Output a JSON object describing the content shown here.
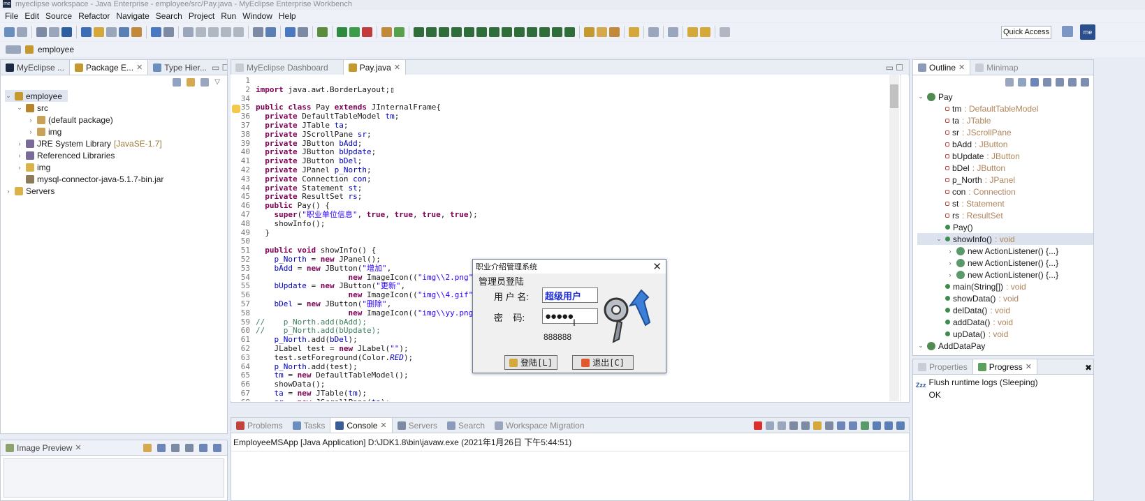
{
  "window": {
    "title": "myeclipse workspace - Java Enterprise - employee/src/Pay.java - MyEclipse Enterprise Workbench",
    "logo": "me"
  },
  "menu": [
    "File",
    "Edit",
    "Source",
    "Refactor",
    "Navigate",
    "Search",
    "Project",
    "Run",
    "Window",
    "Help"
  ],
  "quick_access": "Quick Access",
  "breadcrumb": "employee",
  "left_tabs": [
    {
      "label": "MyEclipse ..."
    },
    {
      "label": "Package E..."
    },
    {
      "label": "Type Hier..."
    }
  ],
  "tree": [
    {
      "label": "employee",
      "level": 0,
      "twisty": "v",
      "icon": "project"
    },
    {
      "label": "src",
      "level": 1,
      "twisty": "v",
      "icon": "srcfolder"
    },
    {
      "label": "(default package)",
      "level": 2,
      "twisty": ">",
      "icon": "package"
    },
    {
      "label": "img",
      "level": 2,
      "twisty": ">",
      "icon": "package"
    },
    {
      "label": "JRE System Library",
      "suffix": "[JavaSE-1.7]",
      "level": 1,
      "twisty": ">",
      "icon": "library"
    },
    {
      "label": "Referenced Libraries",
      "level": 1,
      "twisty": ">",
      "icon": "library"
    },
    {
      "label": "img",
      "level": 1,
      "twisty": ">",
      "icon": "folder"
    },
    {
      "label": "mysql-connector-java-5.1.7-bin.jar",
      "level": 1,
      "twisty": "",
      "icon": "jar"
    },
    {
      "label": "Servers",
      "level": 0,
      "twisty": ">",
      "icon": "folder"
    }
  ],
  "editor_tabs": [
    {
      "label": "MyEclipse Dashboard"
    },
    {
      "label": "Pay.java"
    }
  ],
  "code": [
    {
      "n": "1",
      "t": ""
    },
    {
      "n": "2",
      "t": "import java.awt.BorderLayout;▯"
    },
    {
      "n": "34",
      "t": ""
    },
    {
      "n": "35",
      "t": "public class Pay extends JInternalFrame{"
    },
    {
      "n": "36",
      "t": "  private DefaultTableModel tm;"
    },
    {
      "n": "37",
      "t": "  private JTable ta;"
    },
    {
      "n": "38",
      "t": "  private JScrollPane sr;"
    },
    {
      "n": "39",
      "t": "  private JButton bAdd;"
    },
    {
      "n": "40",
      "t": "  private JButton bUpdate;"
    },
    {
      "n": "41",
      "t": "  private JButton bDel;"
    },
    {
      "n": "42",
      "t": "  private JPanel p_North;"
    },
    {
      "n": "43",
      "t": "  private Connection con;"
    },
    {
      "n": "44",
      "t": "  private Statement st;"
    },
    {
      "n": "45",
      "t": "  private ResultSet rs;"
    },
    {
      "n": "46",
      "t": "  public Pay() {"
    },
    {
      "n": "47",
      "t": "    super(\"职业单位信息\", true, true, true, true);"
    },
    {
      "n": "48",
      "t": "    showInfo();"
    },
    {
      "n": "49",
      "t": "  }"
    },
    {
      "n": "50",
      "t": ""
    },
    {
      "n": "51",
      "t": "  public void showInfo() {"
    },
    {
      "n": "52",
      "t": "    p_North = new JPanel();"
    },
    {
      "n": "53",
      "t": "    bAdd = new JButton(\"增加\","
    },
    {
      "n": "54",
      "t": "                    new ImageIcon((\"img\\\\2.png\"));"
    },
    {
      "n": "55",
      "t": "    bUpdate = new JButton(\"更新\","
    },
    {
      "n": "56",
      "t": "                    new ImageIcon((\"img\\\\4.gif\"));"
    },
    {
      "n": "57",
      "t": "    bDel = new JButton(\"删除\","
    },
    {
      "n": "58",
      "t": "                    new ImageIcon((\"img\\\\yy.png\"));"
    },
    {
      "n": "59",
      "t": "//    p_North.add(bAdd);"
    },
    {
      "n": "60",
      "t": "//    p_North.add(bUpdate);"
    },
    {
      "n": "61",
      "t": "    p_North.add(bDel);"
    },
    {
      "n": "62",
      "t": "    JLabel test = new JLabel(\"\");"
    },
    {
      "n": "63",
      "t": "    test.setForeground(Color.RED);"
    },
    {
      "n": "64",
      "t": "    p_North.add(test);"
    },
    {
      "n": "65",
      "t": "    tm = new DefaultTableModel();"
    },
    {
      "n": "66",
      "t": "    showData();"
    },
    {
      "n": "67",
      "t": "    ta = new JTable(tm);"
    },
    {
      "n": "68",
      "t": "    sr = new JScrollPane(ta);"
    }
  ],
  "outline_tabs": [
    {
      "label": "Outline"
    },
    {
      "label": "Minimap"
    }
  ],
  "outline": [
    {
      "label": "Pay",
      "type": "",
      "level": 0,
      "twisty": "v",
      "icon": "class"
    },
    {
      "label": "tm",
      "type": " : DefaultTableModel",
      "level": 1,
      "icon": "field"
    },
    {
      "label": "ta",
      "type": " : JTable",
      "level": 1,
      "icon": "field"
    },
    {
      "label": "sr",
      "type": " : JScrollPane",
      "level": 1,
      "icon": "field"
    },
    {
      "label": "bAdd",
      "type": " : JButton",
      "level": 1,
      "icon": "field"
    },
    {
      "label": "bUpdate",
      "type": " : JButton",
      "level": 1,
      "icon": "field"
    },
    {
      "label": "bDel",
      "type": " : JButton",
      "level": 1,
      "icon": "field"
    },
    {
      "label": "p_North",
      "type": " : JPanel",
      "level": 1,
      "icon": "field"
    },
    {
      "label": "con",
      "type": " : Connection",
      "level": 1,
      "icon": "field"
    },
    {
      "label": "st",
      "type": " : Statement",
      "level": 1,
      "icon": "field"
    },
    {
      "label": "rs",
      "type": " : ResultSet",
      "level": 1,
      "icon": "field"
    },
    {
      "label": "Pay()",
      "type": "",
      "level": 1,
      "icon": "method"
    },
    {
      "label": "showInfo()",
      "type": " : void",
      "level": 1,
      "twisty": "v",
      "icon": "method",
      "selected": true
    },
    {
      "label": "new ActionListener() {...}",
      "type": "",
      "level": 2,
      "twisty": ">",
      "icon": "anon"
    },
    {
      "label": "new ActionListener() {...}",
      "type": "",
      "level": 2,
      "twisty": ">",
      "icon": "anon"
    },
    {
      "label": "new ActionListener() {...}",
      "type": "",
      "level": 2,
      "twisty": ">",
      "icon": "anon"
    },
    {
      "label": "main(String[])",
      "type": " : void",
      "level": 1,
      "icon": "method"
    },
    {
      "label": "showData()",
      "type": " : void",
      "level": 1,
      "icon": "method"
    },
    {
      "label": "delData()",
      "type": " : void",
      "level": 1,
      "icon": "method"
    },
    {
      "label": "addData()",
      "type": " : void",
      "level": 1,
      "icon": "method"
    },
    {
      "label": "upData()",
      "type": " : void",
      "level": 1,
      "icon": "method"
    },
    {
      "label": "AddDataPay",
      "type": "",
      "level": 0,
      "twisty": "v",
      "icon": "class"
    }
  ],
  "progress_tabs": [
    {
      "label": "Properties"
    },
    {
      "label": "Progress"
    }
  ],
  "progress": {
    "task": "Flush runtime logs (Sleeping)",
    "status": "OK",
    "zzz": "Zzz"
  },
  "console_tabs": [
    {
      "label": "Problems"
    },
    {
      "label": "Tasks"
    },
    {
      "label": "Console"
    },
    {
      "label": "Servers"
    },
    {
      "label": "Search"
    },
    {
      "label": "Workspace Migration"
    }
  ],
  "console": {
    "header": "EmployeeMSApp [Java Application] D:\\JDK1.8\\bin\\javaw.exe (2021年1月26日 下午5:44:51)"
  },
  "image_preview": {
    "label": "Image Preview"
  },
  "dialog": {
    "title": "职业介绍管理系统",
    "heading": "管理员登陆",
    "user_label": "用 户 名:",
    "user_value": "超级用户",
    "pass_label": "密    码:",
    "pass_value": "●●●●●",
    "hint": "888888",
    "login_label": "登陆[L]",
    "exit_label": "退出[C]"
  }
}
